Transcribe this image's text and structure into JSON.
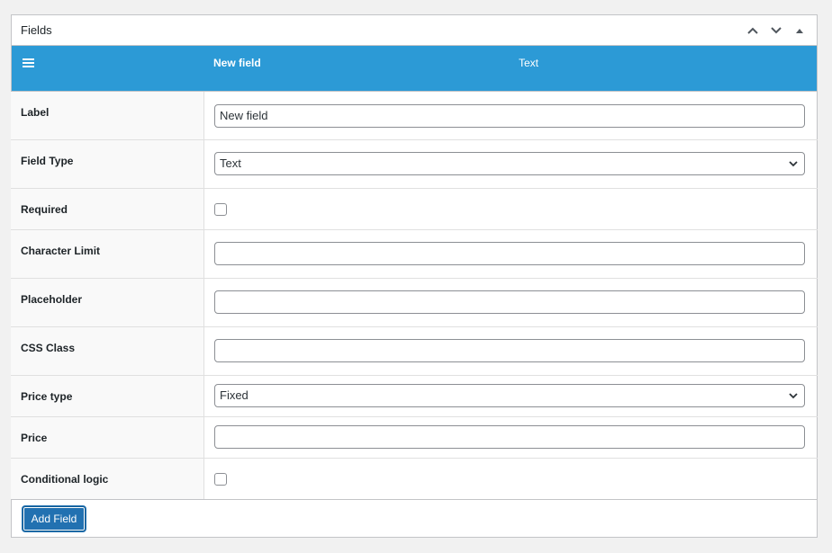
{
  "panel": {
    "title": "Fields"
  },
  "field_bar": {
    "name": "New field",
    "type": "Text"
  },
  "rows": {
    "label": {
      "label": "Label",
      "value": "New field"
    },
    "field_type": {
      "label": "Field Type",
      "value": "Text"
    },
    "required": {
      "label": "Required"
    },
    "character_limit": {
      "label": "Character Limit",
      "value": ""
    },
    "placeholder": {
      "label": "Placeholder",
      "value": ""
    },
    "css_class": {
      "label": "CSS Class",
      "value": ""
    },
    "price_type": {
      "label": "Price type",
      "value": "Fixed"
    },
    "price": {
      "label": "Price",
      "value": ""
    },
    "conditional_logic": {
      "label": "Conditional logic"
    }
  },
  "footer": {
    "add_field_label": "Add Field"
  },
  "colors": {
    "bar": "#2c9ad6",
    "primary_button": "#2271b1"
  },
  "icons": [
    "chevron-up-icon",
    "chevron-down-icon",
    "collapse-triangle-icon",
    "menu-icon",
    "dropdown-chevron-icon"
  ]
}
